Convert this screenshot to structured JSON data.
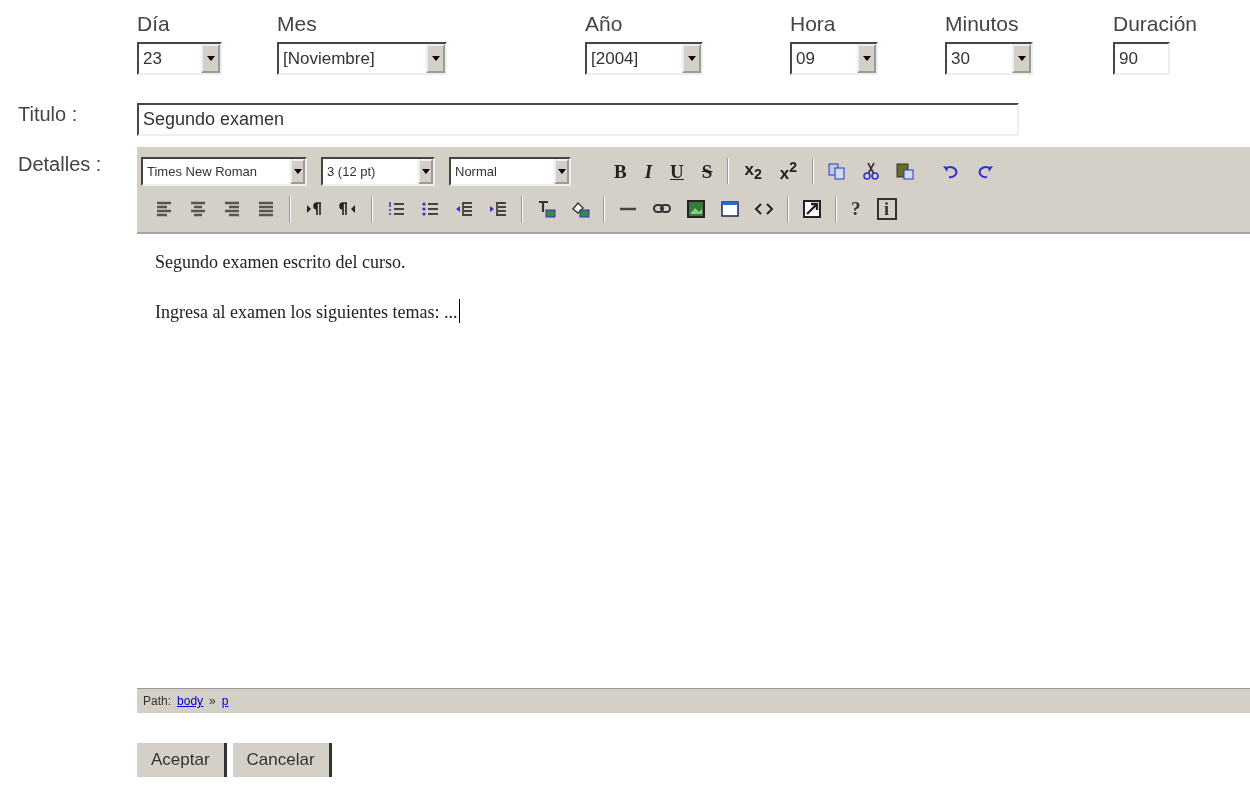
{
  "date_fields": [
    {
      "label": "Día",
      "kind": "select",
      "value": "23"
    },
    {
      "label": "Mes",
      "kind": "select",
      "value": "[Noviembre]"
    },
    {
      "label": "Año",
      "kind": "select",
      "value": "[2004]"
    },
    {
      "label": "Hora",
      "kind": "select",
      "value": "09"
    },
    {
      "label": "Minutos",
      "kind": "select",
      "value": "30"
    },
    {
      "label": "Duración",
      "kind": "text",
      "value": "90"
    }
  ],
  "title_field": {
    "label": "Titulo :",
    "value": "Segundo examen"
  },
  "details": {
    "label": "Detalles :",
    "toolbar": {
      "font_select": "Times New Roman",
      "size_select": "3 (12 pt)",
      "format_select": "Normal",
      "style_buttons": [
        "B",
        "I",
        "U",
        "S"
      ],
      "script_buttons": [
        "x$_{2}$",
        "x$^{2}$"
      ],
      "help_button": "?",
      "info_button": "i"
    },
    "paragraphs": [
      "Segundo examen escrito del curso.",
      "Ingresa al examen los siguientes temas: ..."
    ],
    "path": {
      "label": "Path:",
      "items": [
        {
          "kind": "link",
          "text": "body"
        },
        {
          "kind": "sep",
          "text": "»"
        },
        {
          "kind": "link",
          "text": "p"
        }
      ]
    }
  },
  "buttons": [
    "Aceptar",
    "Cancelar"
  ]
}
